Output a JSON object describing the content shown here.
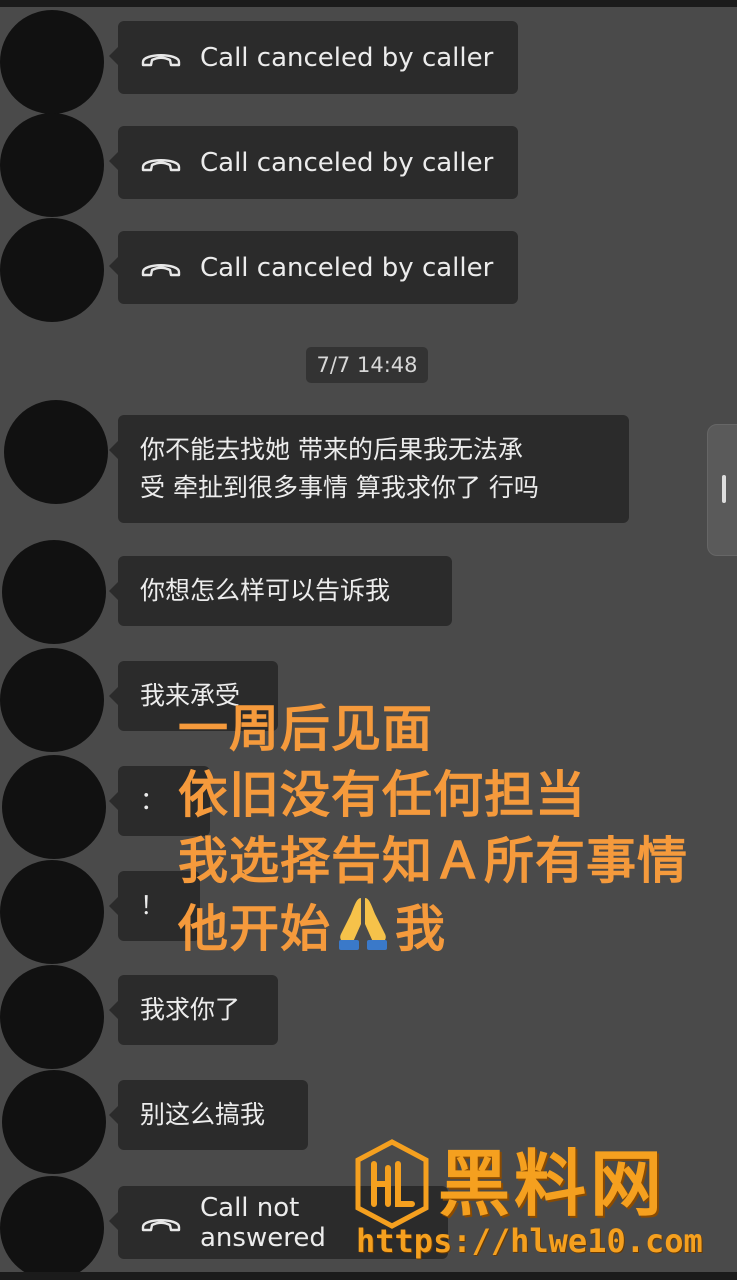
{
  "chat": {
    "timestamp": "7/7 14:48",
    "messages": [
      {
        "type": "call",
        "text": "Call canceled by caller"
      },
      {
        "type": "call",
        "text": "Call canceled by caller"
      },
      {
        "type": "call",
        "text": "Call canceled by caller"
      },
      {
        "type": "text",
        "lines": [
          "你不能去找她 带来的后果我无法承",
          "受 牵扯到很多事情 算我求你了 行吗"
        ]
      },
      {
        "type": "text",
        "text": "你想怎么样可以告诉我"
      },
      {
        "type": "text",
        "text": "我来承受"
      },
      {
        "type": "text",
        "text": "："
      },
      {
        "type": "text",
        "text": "！"
      },
      {
        "type": "text",
        "text": "我求你了"
      },
      {
        "type": "text",
        "text": "别这么搞我"
      },
      {
        "type": "call",
        "text": "Call not answered"
      }
    ]
  },
  "overlay": {
    "line1": "一周后见面",
    "line2": "依旧没有任何担当",
    "line3": "我选择告知Ａ所有事情",
    "line4_a": "他开始",
    "line4_b": "我",
    "emoji": "folded-hands-icon"
  },
  "watermark": {
    "brand": "黑料网",
    "url": "https://hlwe10.com",
    "color": "#f5a01f"
  },
  "colors": {
    "background": "#4a4a4a",
    "bubble": "#2b2b2b",
    "overlay_text": "#f59a3c"
  }
}
